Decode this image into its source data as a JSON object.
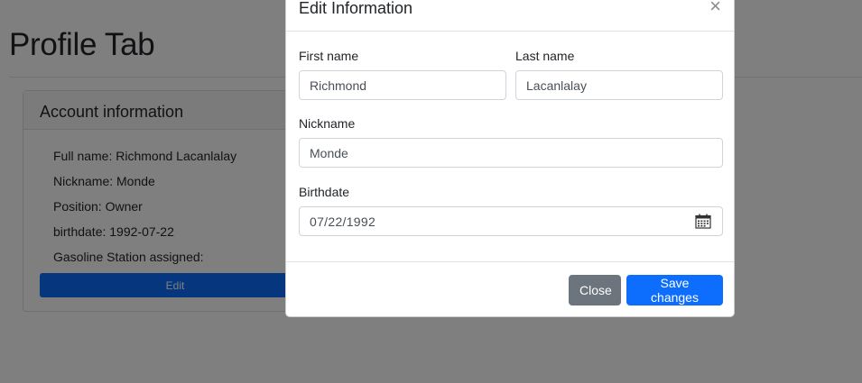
{
  "page": {
    "title": "Profile Tab"
  },
  "account_card": {
    "header": "Account information",
    "lines": [
      "Full name: Richmond Lacanlalay",
      "Nickname: Monde",
      "Position: Owner",
      "birthdate: 1992-07-22",
      "Gasoline Station assigned:"
    ],
    "edit_label": "Edit"
  },
  "modal": {
    "title": "Edit Information",
    "close_glyph": "×",
    "first_name": {
      "label": "First name",
      "value": "Richmond"
    },
    "last_name": {
      "label": "Last name",
      "value": "Lacanlalay"
    },
    "nickname": {
      "label": "Nickname",
      "value": "Monde"
    },
    "birthdate": {
      "label": "Birthdate",
      "value": "07/22/1992",
      "icon": "calendar-icon"
    },
    "buttons": {
      "close": "Close",
      "save": "Save changes"
    }
  },
  "colors": {
    "primary": "#0d6efd",
    "secondary": "#6c757d",
    "backdrop": "rgba(0,0,0,0.5)"
  }
}
